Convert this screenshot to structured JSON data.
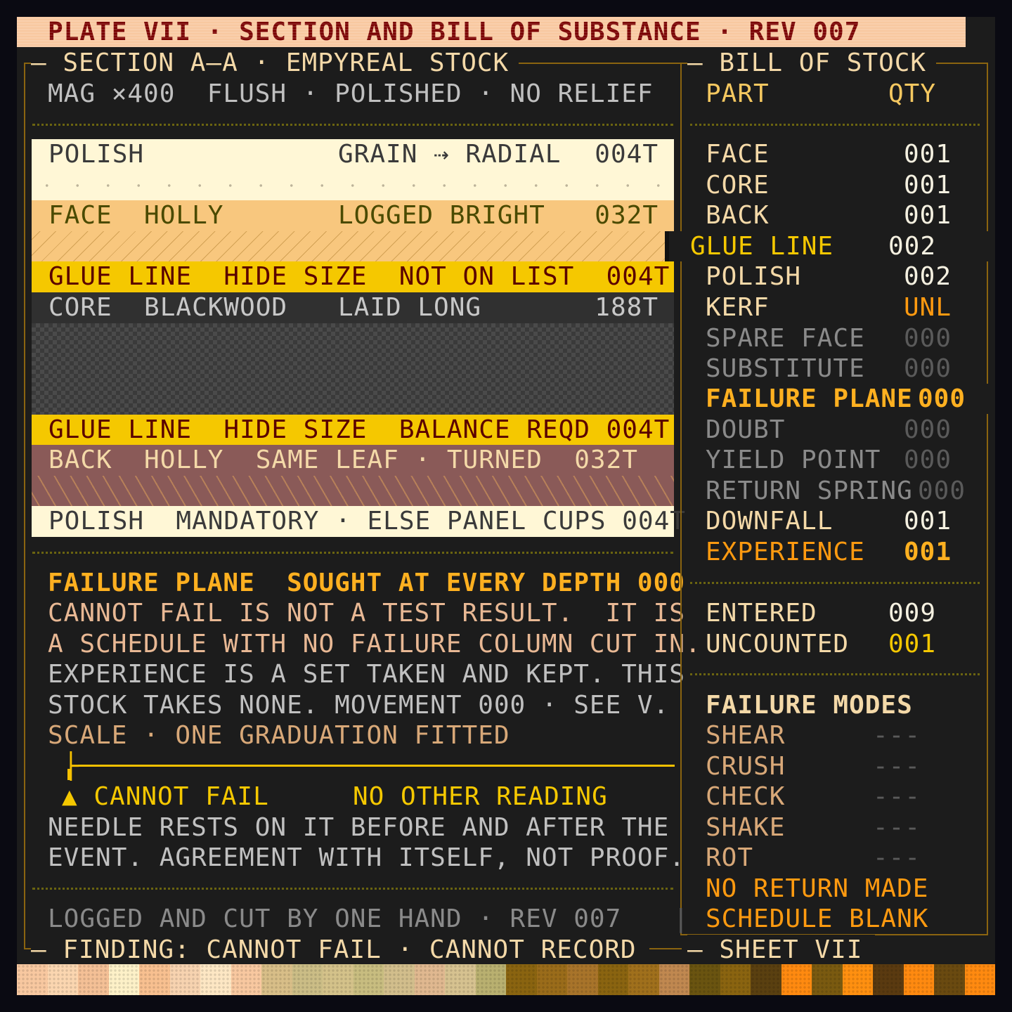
{
  "title": "PLATE VII · SECTION AND BILL OF SUBSTANCE · REV 007",
  "section": {
    "heading": "— SECTION A—A · EMPYREAL STOCK",
    "subheading": "MAG ×400  FLUSH · POLISHED · NO RELIEF",
    "layers": [
      {
        "left": "POLISH",
        "mid": "GRAIN ⇢ RADIAL",
        "thick": "004T"
      },
      {
        "left": "FACE  HOLLY",
        "mid": "LOGGED BRIGHT",
        "thick": "032T"
      },
      {
        "text": "GLUE LINE  HIDE SIZE  NOT ON LIST  004T"
      },
      {
        "left": "CORE  BLACKWOOD",
        "mid": "LAID LONG",
        "thick": "188T"
      },
      {
        "text": "GLUE LINE  HIDE SIZE  BALANCE REQD 004T"
      },
      {
        "text": "BACK  HOLLY  SAME LEAF · TURNED  032T"
      },
      {
        "text": "POLISH  MANDATORY · ELSE PANEL CUPS 004T"
      }
    ],
    "finding_heading": "FAILURE PLANE  SOUGHT AT EVERY DEPTH 000",
    "finding_lines": [
      "CANNOT FAIL IS NOT A TEST RESULT.  IT IS",
      "A SCHEDULE WITH NO FAILURE COLUMN CUT IN.",
      "EXPERIENCE IS A SET TAKEN AND KEPT. THIS",
      "STOCK TAKES NONE. MOVEMENT 000 · SEE V."
    ],
    "scale_label": "SCALE · ONE GRADUATION FITTED",
    "scale_graphic": "├────────────────────────────────────────",
    "marker": "▲ CANNOT FAIL",
    "marker_note": "NO OTHER READING",
    "needle_lines": [
      "NEEDLE RESTS ON IT BEFORE AND AFTER THE",
      "EVENT. AGREEMENT WITH ITSELF, NOT PROOF."
    ],
    "footer": "LOGGED AND CUT BY ONE HAND · REV 007",
    "finding": "— FINDING: CANNOT FAIL · CANNOT RECORD"
  },
  "bill": {
    "heading": "— BILL OF STOCK",
    "col_part": "PART",
    "col_qty": "QTY",
    "items": [
      {
        "part": "FACE",
        "qty": "001"
      },
      {
        "part": "CORE",
        "qty": "001"
      },
      {
        "part": "BACK",
        "qty": "001"
      },
      {
        "part": "GLUE LINE",
        "qty": "002"
      },
      {
        "part": "POLISH",
        "qty": "002"
      },
      {
        "part": "KERF",
        "qty": "UNL"
      },
      {
        "part": "SPARE FACE",
        "qty": "000"
      },
      {
        "part": "SUBSTITUTE",
        "qty": "000"
      },
      {
        "part": "FAILURE PLANE",
        "qty": "000"
      },
      {
        "part": "DOUBT",
        "qty": "000"
      },
      {
        "part": "YIELD POINT",
        "qty": "000"
      },
      {
        "part": "RETURN SPRING",
        "qty": "000"
      },
      {
        "part": "DOWNFALL",
        "qty": "001"
      },
      {
        "part": "EXPERIENCE",
        "qty": "001"
      }
    ],
    "entered_label": "ENTERED",
    "entered_qty": "009",
    "uncounted_label": "UNCOUNTED",
    "uncounted_qty": "001",
    "modes_heading": "FAILURE MODES",
    "modes": [
      {
        "name": "SHEAR",
        "val": "---"
      },
      {
        "name": "CRUSH",
        "val": "---"
      },
      {
        "name": "CHECK",
        "val": "---"
      },
      {
        "name": "SHAKE",
        "val": "---"
      },
      {
        "name": "ROT",
        "val": "---"
      }
    ],
    "note1": "NO RETURN MADE",
    "note2": "SCHEDULE BLANK",
    "sheet": "— SHEET VII",
    "pipe": "|"
  },
  "swatches": [
    "#f8c8a0",
    "#fbd6b0",
    "#f4c096",
    "#fdf1c8",
    "#f8c090",
    "#f7d3b0",
    "#fde7c4",
    "#f8c8a0",
    "#d8be88",
    "#cbbd86",
    "#d4c28a",
    "#c8bd80",
    "#d2be8c",
    "#e0b890",
    "#d6c290",
    "#b9b070",
    "#8a6410",
    "#9a6c1a",
    "#a8742a",
    "#8a6410",
    "#a0701c",
    "#c08850",
    "#6a5410",
    "#8a6410",
    "#5a4010",
    "#ff8a10",
    "#7a5a10",
    "#ff9010",
    "#5a3a10",
    "#ff8a10",
    "#6a4a10",
    "#ff8a10"
  ]
}
